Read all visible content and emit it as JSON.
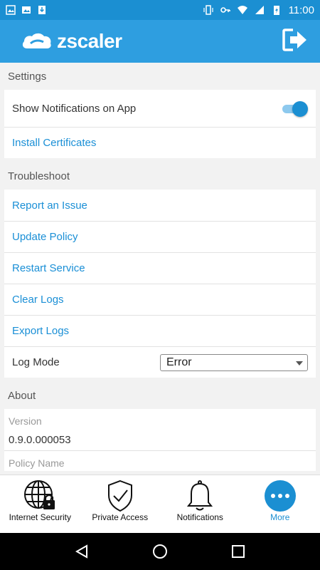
{
  "status_bar": {
    "time": "11:00",
    "icons": [
      "image-icon",
      "gallery-icon",
      "download-icon",
      "vibrate-icon",
      "key-icon",
      "wifi-icon",
      "signal-icon",
      "battery-charging-icon"
    ]
  },
  "app_bar": {
    "logo_text": "zscaler",
    "exit_icon": "logout-icon"
  },
  "settings": {
    "title": "Settings",
    "show_notifications_label": "Show Notifications on App",
    "show_notifications_enabled": true,
    "install_certificates_label": "Install Certificates"
  },
  "troubleshoot": {
    "title": "Troubleshoot",
    "items": [
      {
        "label": "Report an Issue"
      },
      {
        "label": "Update Policy"
      },
      {
        "label": "Restart Service"
      },
      {
        "label": "Clear Logs"
      },
      {
        "label": "Export Logs"
      }
    ],
    "log_mode_label": "Log Mode",
    "log_mode_value": "Error"
  },
  "about": {
    "title": "About",
    "version_label": "Version",
    "version_value": "0.9.0.000053",
    "policy_name_label": "Policy Name"
  },
  "bottom_nav": {
    "items": [
      {
        "label": "Internet Security",
        "icon": "globe-lock-icon"
      },
      {
        "label": "Private Access",
        "icon": "shield-check-icon"
      },
      {
        "label": "Notifications",
        "icon": "bell-icon"
      },
      {
        "label": "More",
        "icon": "more-dots-icon",
        "active": true
      }
    ]
  },
  "colors": {
    "status_bar": "#1b8fd2",
    "app_bar": "#2e9ee0",
    "link": "#1a8fd6",
    "accent": "#1b8fd2"
  }
}
